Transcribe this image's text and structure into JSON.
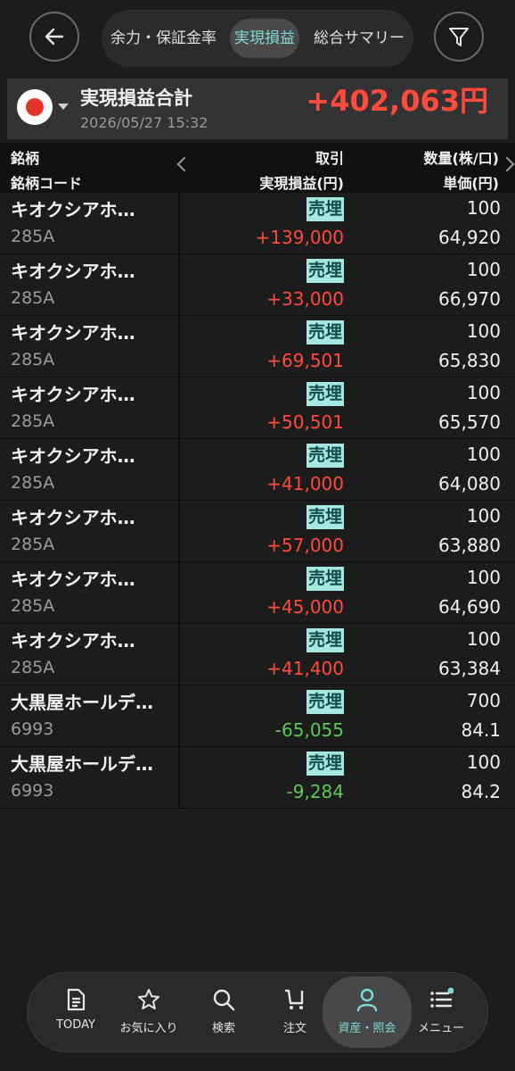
{
  "header": {
    "tabs": [
      {
        "label": "余力・保証金率"
      },
      {
        "label": "実現損益"
      },
      {
        "label": "総合サマリー"
      }
    ]
  },
  "summary": {
    "title": "実現損益合計",
    "datetime": "2026/05/27 15:32",
    "total": "+402,063円"
  },
  "columns": {
    "col1_line1": "銘柄",
    "col1_line2": "銘柄コード",
    "col2_line1": "取引",
    "col2_line2": "実現損益(円)",
    "col3_line1": "数量(株/口)",
    "col3_line2": "単価(円)"
  },
  "rows": [
    {
      "name": "キオクシアホ…",
      "code": "285A",
      "trade": "売埋",
      "pl": "+139,000",
      "sign": "pos",
      "qty": "100",
      "price": "64,920"
    },
    {
      "name": "キオクシアホ…",
      "code": "285A",
      "trade": "売埋",
      "pl": "+33,000",
      "sign": "pos",
      "qty": "100",
      "price": "66,970"
    },
    {
      "name": "キオクシアホ…",
      "code": "285A",
      "trade": "売埋",
      "pl": "+69,501",
      "sign": "pos",
      "qty": "100",
      "price": "65,830"
    },
    {
      "name": "キオクシアホ…",
      "code": "285A",
      "trade": "売埋",
      "pl": "+50,501",
      "sign": "pos",
      "qty": "100",
      "price": "65,570"
    },
    {
      "name": "キオクシアホ…",
      "code": "285A",
      "trade": "売埋",
      "pl": "+41,000",
      "sign": "pos",
      "qty": "100",
      "price": "64,080"
    },
    {
      "name": "キオクシアホ…",
      "code": "285A",
      "trade": "売埋",
      "pl": "+57,000",
      "sign": "pos",
      "qty": "100",
      "price": "63,880"
    },
    {
      "name": "キオクシアホ…",
      "code": "285A",
      "trade": "売埋",
      "pl": "+45,000",
      "sign": "pos",
      "qty": "100",
      "price": "64,690"
    },
    {
      "name": "キオクシアホ…",
      "code": "285A",
      "trade": "売埋",
      "pl": "+41,400",
      "sign": "pos",
      "qty": "100",
      "price": "63,384"
    },
    {
      "name": "大黒屋ホールデ…",
      "code": "6993",
      "trade": "売埋",
      "pl": "-65,055",
      "sign": "neg",
      "qty": "700",
      "price": "84.1"
    },
    {
      "name": "大黒屋ホールデ…",
      "code": "6993",
      "trade": "売埋",
      "pl": "-9,284",
      "sign": "neg",
      "qty": "100",
      "price": "84.2"
    }
  ],
  "bottom_nav": [
    {
      "label": "TODAY",
      "icon": "document-icon"
    },
    {
      "label": "お気に入り",
      "icon": "star-icon"
    },
    {
      "label": "検索",
      "icon": "search-icon"
    },
    {
      "label": "注文",
      "icon": "cart-icon"
    },
    {
      "label": "資産・照会",
      "icon": "person-icon",
      "active": true
    },
    {
      "label": "メニュー",
      "icon": "menu-icon"
    }
  ],
  "colors": {
    "positive": "#ff4a3d",
    "negative": "#5ac75a",
    "accent": "#7fd9d4",
    "badge_bg": "#a7e7e2"
  }
}
